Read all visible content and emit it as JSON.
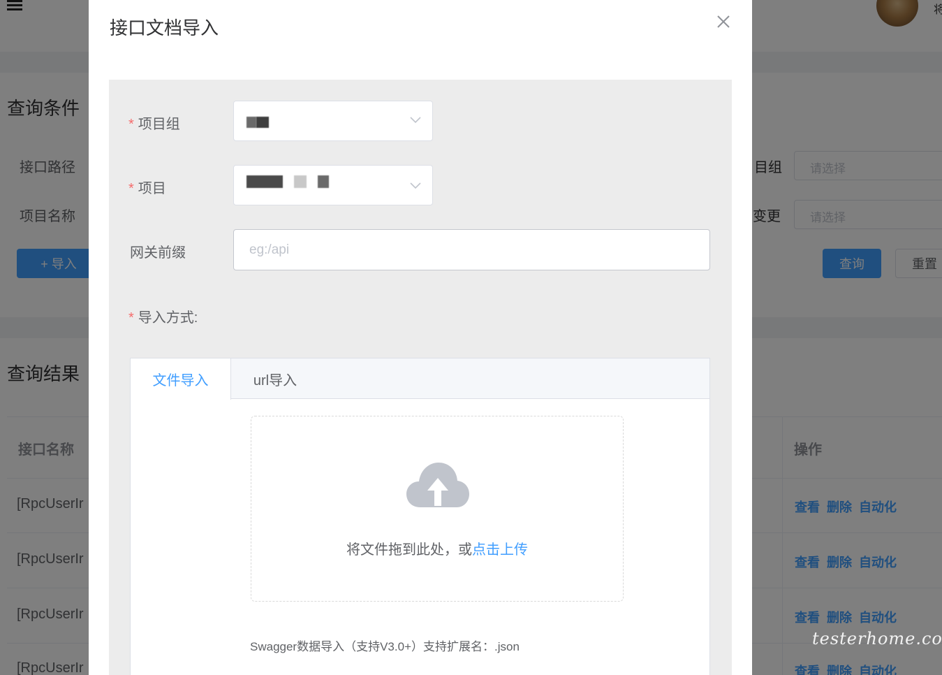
{
  "background": {
    "user_name_char": "将",
    "query_section": {
      "title": "查询条件",
      "field_path_label": "接口路径",
      "field_name_label": "项目名称",
      "right_label_1": "目组",
      "right_label_2": "变更",
      "select_placeholder_1": "请选择",
      "select_placeholder_2": "请选择",
      "import_button": "+ 导入",
      "search_button": "查询",
      "reset_button": "重置"
    },
    "result_section": {
      "title": "查询结果",
      "col_name_header": "接口名称",
      "col_ops_header": "操作",
      "rows": [
        {
          "name": "[RpcUserIr",
          "ops": [
            "查看",
            "删除",
            "自动化"
          ]
        },
        {
          "name": "[RpcUserIr",
          "ops": [
            "查看",
            "删除",
            "自动化"
          ]
        },
        {
          "name": "[RpcUserIr",
          "ops": [
            "查看",
            "删除",
            "自动化"
          ]
        },
        {
          "name": "[RpcUserIr",
          "ops": [
            "查看",
            "删除",
            "自动化"
          ]
        }
      ]
    }
  },
  "dialog": {
    "title": "接口文档导入",
    "project_group_label": "项目组",
    "project_label": "项目",
    "gateway_label": "网关前缀",
    "gateway_placeholder": "eg:/api",
    "gateway_value": "",
    "import_mode_label": "导入方式:",
    "tabs": [
      {
        "label": "文件导入",
        "active": true
      },
      {
        "label": "url导入",
        "active": false
      }
    ],
    "drop_text": "将文件拖到此处，或",
    "upload_link": "点击上传",
    "tip": "Swagger数据导入（支持V3.0+）支持扩展名：.json"
  },
  "watermark": "testerhome.com",
  "colors": {
    "primary": "#409eff",
    "required": "#f56c6c",
    "overlay": "rgba(0,0,0,0.5)"
  }
}
